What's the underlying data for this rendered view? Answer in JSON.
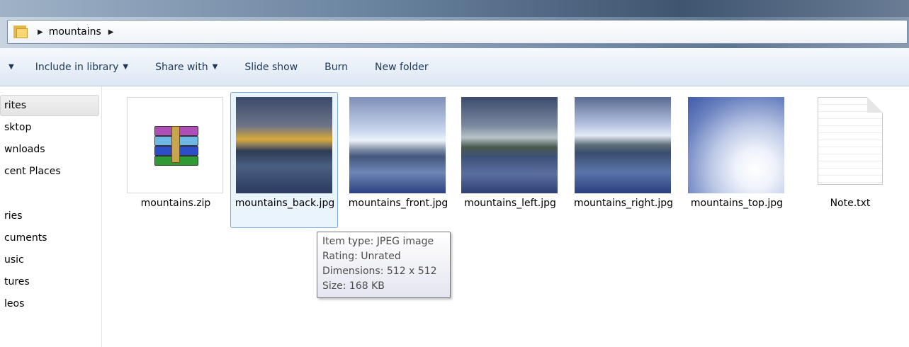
{
  "address": {
    "crumb": "mountains"
  },
  "toolbar": {
    "include_in_library": "Include in library",
    "share_with": "Share with",
    "slide_show": "Slide show",
    "burn": "Burn",
    "new_folder": "New folder"
  },
  "nav": {
    "items": [
      "rites",
      "sktop",
      "wnloads",
      "cent Places",
      "ries",
      "cuments",
      "usic",
      "tures",
      "leos"
    ]
  },
  "files": [
    {
      "name": "mountains.zip",
      "type": "zip"
    },
    {
      "name": "mountains_back.jpg",
      "type": "image",
      "selected": true
    },
    {
      "name": "mountains_front.jpg",
      "type": "image"
    },
    {
      "name": "mountains_left.jpg",
      "type": "image"
    },
    {
      "name": "mountains_right.jpg",
      "type": "image"
    },
    {
      "name": "mountains_top.jpg",
      "type": "image"
    },
    {
      "name": "Note.txt",
      "type": "text"
    }
  ],
  "tooltip": {
    "item_type": "Item type: JPEG image",
    "rating": "Rating: Unrated",
    "dimensions": "Dimensions: 512 x 512",
    "size": "Size: 168 KB"
  },
  "colors": {
    "accent": "#1e395b",
    "selection": "#eaf4fd",
    "selection_border": "#84acdd"
  }
}
